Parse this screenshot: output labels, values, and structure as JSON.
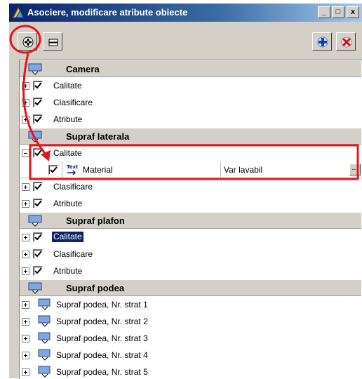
{
  "window": {
    "title": "Asociere, modificare atribute obiecte",
    "caption_buttons": [
      "_",
      "□",
      "x"
    ]
  },
  "toolbar": {
    "left_buttons": [
      "add-attribute-icon",
      "expand-collapse-icon"
    ],
    "right_buttons": [
      "add-blue-cross-icon",
      "delete-red-x-icon"
    ]
  },
  "tree": {
    "groups": [
      {
        "name": "Camera",
        "items": [
          "Calitate",
          "Clasificare",
          "Atribute"
        ]
      },
      {
        "name": "Supraf laterala",
        "items": [
          "Calitate",
          "Clasificare",
          "Atribute"
        ],
        "attribute": {
          "name": "Material",
          "icon_label": "Text",
          "value": "Var lavabil",
          "button": "..."
        }
      },
      {
        "name": "Supraf plafon",
        "items": [
          "Calitate",
          "Clasificare",
          "Atribute"
        ],
        "selected": "Calitate"
      },
      {
        "name": "Supraf podea",
        "layers": [
          "Supraf podea, Nr. strat 1",
          "Supraf podea, Nr. strat 2",
          "Supraf podea, Nr. strat 3",
          "Supraf podea, Nr. strat 4",
          "Supraf podea, Nr. strat 5"
        ]
      }
    ]
  },
  "annotation": {
    "color": "#e8141c"
  }
}
